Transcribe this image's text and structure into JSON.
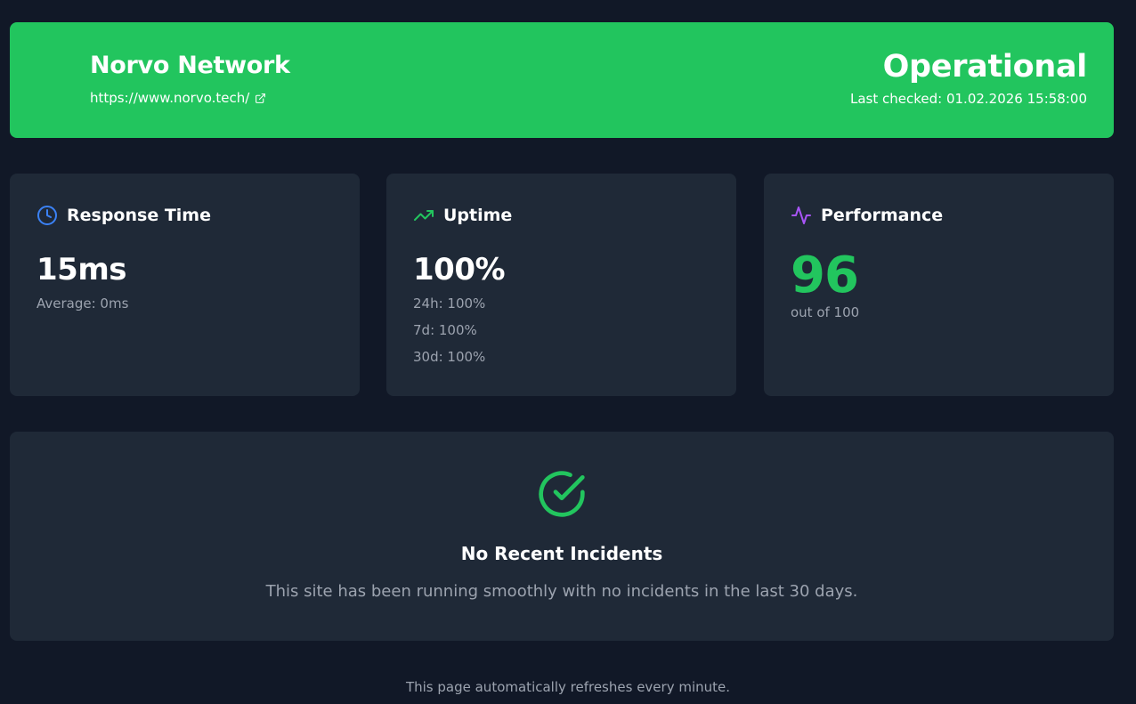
{
  "site": {
    "name": "Norvo Network",
    "url": "https://www.norvo.tech/",
    "status": "Operational",
    "last_checked": "Last checked: 01.02.2026 15:58:00"
  },
  "colors": {
    "background": "#111827",
    "card": "#1f2937",
    "operational": "#22c55e",
    "muted_text": "#9ca3af",
    "clock_icon": "#3b82f6",
    "uptime_icon": "#22c55e",
    "performance_icon": "#a855f7"
  },
  "cards": {
    "response": {
      "icon": "clock-icon",
      "title": "Response Time",
      "value": "15ms",
      "average": "Average: 0ms"
    },
    "uptime": {
      "icon": "trending-up-icon",
      "title": "Uptime",
      "value": "100%",
      "stats": [
        "24h: 100%",
        "7d: 100%",
        "30d: 100%"
      ]
    },
    "performance": {
      "icon": "activity-icon",
      "title": "Performance",
      "score": "96",
      "scale": "out of 100"
    }
  },
  "incidents": {
    "icon": "check-circle-icon",
    "title": "No Recent Incidents",
    "message": "This site has been running smoothly with no incidents in the last 30 days."
  },
  "footer": {
    "text": "This page automatically refreshes every minute."
  }
}
